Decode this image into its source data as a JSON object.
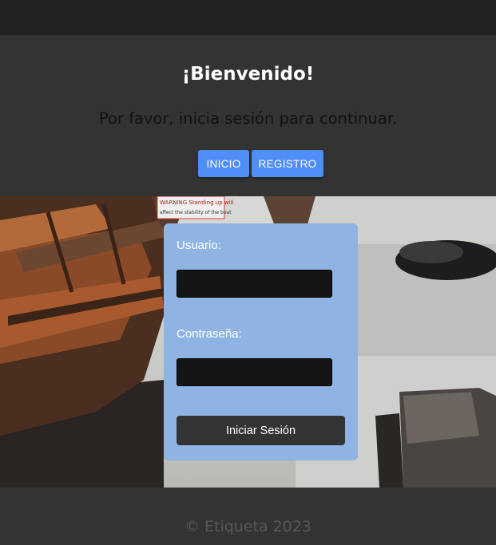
{
  "hero": {
    "title": "¡Bienvenido!",
    "subtitle": "Por favor, inicia sesión para continuar.",
    "buttons": {
      "inicio": "INICIO",
      "registro": "REGISTRO"
    }
  },
  "photo": {
    "sign_text_1": "WARNING Standing up will",
    "sign_text_2": "affect the stability of the boat"
  },
  "login": {
    "user_label": "Usuario:",
    "user_value": "",
    "password_label": "Contraseña:",
    "password_value": "",
    "submit_label": "Iniciar Sesión"
  },
  "footer": {
    "copyright": "© Etiqueta 2023"
  },
  "colors": {
    "accent": "#4f8ef7",
    "card": "#8fb3e2",
    "background": "#333333",
    "topbar": "#222222"
  }
}
